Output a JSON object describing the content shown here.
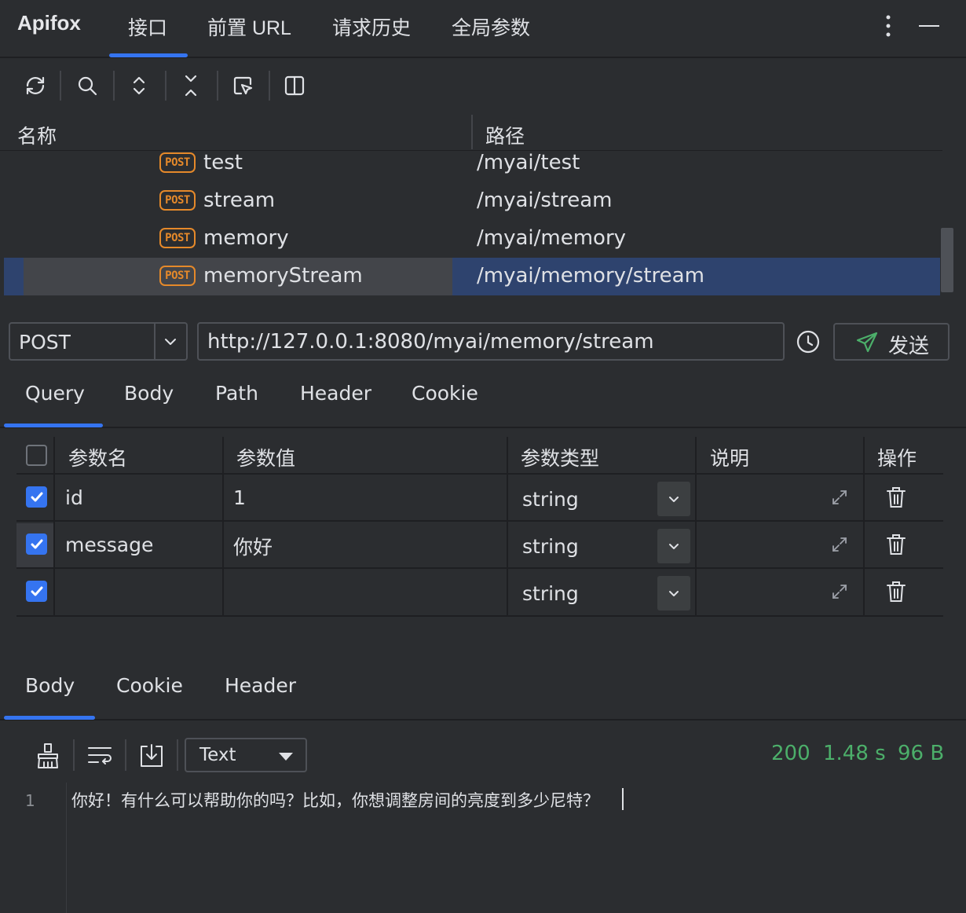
{
  "app": {
    "title": "Apifox"
  },
  "top_tabs": [
    "接口",
    "前置 URL",
    "请求历史",
    "全局参数"
  ],
  "api_list": {
    "columns": {
      "name": "名称",
      "path": "路径"
    },
    "rows": [
      {
        "method": "POST",
        "name": "test",
        "path": "/myai/test"
      },
      {
        "method": "POST",
        "name": "stream",
        "path": "/myai/stream"
      },
      {
        "method": "POST",
        "name": "memory",
        "path": "/myai/memory"
      },
      {
        "method": "POST",
        "name": "memoryStream",
        "path": "/myai/memory/stream"
      }
    ]
  },
  "request": {
    "method": "POST",
    "url": "http://127.0.0.1:8080/myai/memory/stream",
    "send_label": "发送"
  },
  "request_tabs": [
    "Query",
    "Body",
    "Path",
    "Header",
    "Cookie"
  ],
  "params": {
    "headers": {
      "name": "参数名",
      "value": "参数值",
      "type": "参数类型",
      "desc": "说明",
      "ops": "操作"
    },
    "rows": [
      {
        "checked": true,
        "name": "id",
        "value": "1",
        "type": "string"
      },
      {
        "checked": true,
        "name": "message",
        "value": "你好",
        "type": "string"
      },
      {
        "checked": true,
        "name": "",
        "value": "",
        "type": "string"
      }
    ]
  },
  "response_tabs": [
    "Body",
    "Cookie",
    "Header"
  ],
  "response": {
    "format": "Text",
    "status": "200",
    "time": "1.48 s",
    "size": "96 B",
    "line_number": "1",
    "body": "你好！有什么可以帮助你的吗？比如，你想调整房间的亮度到多少尼特？"
  },
  "colors": {
    "accent": "#3574f0",
    "post_badge": "#e5892a",
    "status_ok": "#4caf6a",
    "selected_row": "#2e436e"
  }
}
